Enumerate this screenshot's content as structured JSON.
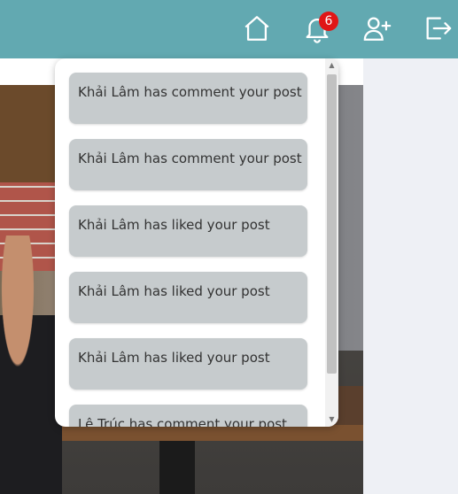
{
  "header": {
    "notification_count": "6",
    "icons": [
      "home-icon",
      "bell-icon",
      "add-user-icon",
      "logout-icon"
    ]
  },
  "notifications": [
    {
      "text": "Khải Lâm has comment your post"
    },
    {
      "text": "Khải Lâm has comment your post"
    },
    {
      "text": "Khải Lâm has liked your post"
    },
    {
      "text": "Khải Lâm has liked your post"
    },
    {
      "text": "Khải Lâm has liked your post"
    },
    {
      "text": "Lê Trúc has comment your post"
    }
  ],
  "colors": {
    "topbar": "#62a9b1",
    "badge": "#e01616",
    "notification_bg": "#c6cbcd"
  }
}
